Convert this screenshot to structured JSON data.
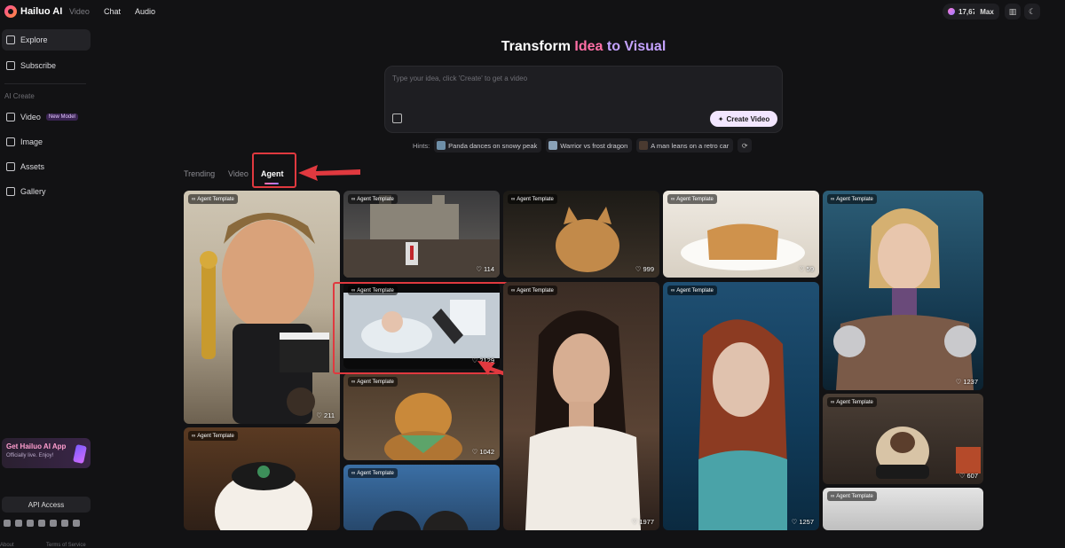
{
  "app": {
    "logo_text": "Hailuo AI"
  },
  "topnav": {
    "video": "Video",
    "chat": "Chat",
    "audio": "Audio"
  },
  "header_right": {
    "credits": "17,673",
    "plan": "Max"
  },
  "sidebar": {
    "explore": "Explore",
    "subscribe": "Subscribe",
    "section_title": "AI Create",
    "video": "Video",
    "new_model_badge": "New Model",
    "image": "Image",
    "assets": "Assets",
    "gallery": "Gallery",
    "app_card_title": "Get Hailuo AI App",
    "app_card_sub": "Officially live. Enjoy!",
    "api_access": "API Access",
    "footer_about": "About",
    "footer_terms": "Terms of Service"
  },
  "hero": {
    "title_part1": "Transform ",
    "title_idea": "Idea",
    "title_to": " to ",
    "title_visual": "Visual"
  },
  "prompt": {
    "placeholder": "Type your idea, click 'Create' to get a video",
    "create_label": "Create Video"
  },
  "hints": {
    "label": "Hints:",
    "items": [
      "Panda dances on snowy peak",
      "Warrior vs frost dragon",
      "A man leans on a retro car"
    ]
  },
  "tabs": {
    "trending": "Trending",
    "video": "Video",
    "agent": "Agent"
  },
  "cards": {
    "badge": "Agent Template",
    "likes": [
      "211",
      "114",
      "2129",
      "1042",
      "999",
      "1977",
      "59",
      "1257",
      "1237",
      "607"
    ]
  },
  "colors": {
    "accent_pink": "#ff6fa6",
    "accent_purple": "#c4a2ff",
    "highlight_red": "#e0393f"
  }
}
